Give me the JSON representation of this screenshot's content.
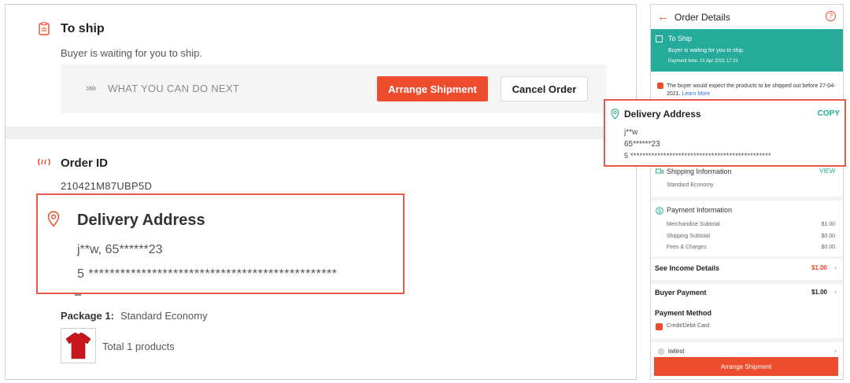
{
  "desktop": {
    "to_ship": {
      "title": "To ship",
      "subtitle": "Buyer is waiting for you to ship.",
      "next_label": "WHAT YOU CAN DO NEXT",
      "next_chevrons": "»»",
      "arrange_button": "Arrange Shipment",
      "cancel_button": "Cancel Order"
    },
    "order": {
      "title": "Order ID",
      "id": "210421M87UBP5D"
    },
    "delivery_address": {
      "title": "Delivery Address",
      "line1": "j**w, 65******23",
      "line2": "5 ***********************************************"
    },
    "package": {
      "label": "Package 1:",
      "value": "Standard Economy",
      "total": "Total 1 products"
    }
  },
  "mobile": {
    "header": {
      "back": "←",
      "title": "Order Details",
      "help": "?"
    },
    "status": {
      "title": "To Ship",
      "subtitle": "Buyer is waiting for you to ship.",
      "payment_time": "Payment time: 21 Apr 2021 17:21"
    },
    "notice": {
      "text": "The buyer would expect the products to be shipped out before 27-04-2021.",
      "link": "Learn More"
    },
    "delivery_address": {
      "title": "Delivery Address",
      "copy": "COPY",
      "line1": "j**w",
      "line2": "65******23",
      "line3": "5 ***********************************************"
    },
    "shipping": {
      "title": "Shipping Information",
      "view": "VIEW",
      "method": "Standard Economy"
    },
    "payment": {
      "title": "Payment Information",
      "rows": [
        {
          "label": "Merchandise Subtotal",
          "value": "$1.00"
        },
        {
          "label": "Shipping Subtotal",
          "value": "$0.00"
        },
        {
          "label": "Fees & Charges",
          "value": "$0.00"
        }
      ]
    },
    "income": {
      "label": "See Income Details",
      "value": "$1.00"
    },
    "buyer_payment": {
      "label": "Buyer Payment",
      "value": "$1.00"
    },
    "payment_method": {
      "title": "Payment Method",
      "value": "Credit/Debit Card"
    },
    "buyer": {
      "name": "iwtest"
    },
    "arrange_button": "Arrange Shipment"
  },
  "colors": {
    "accent": "#ee4d2d",
    "teal": "#26aa99",
    "highlight_border": "#e8584a"
  }
}
